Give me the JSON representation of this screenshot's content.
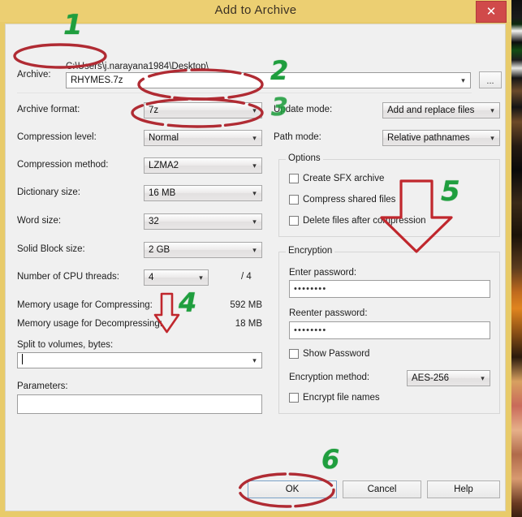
{
  "window": {
    "title": "Add to Archive",
    "close_label": "✕",
    "chrome_color": "#e8cb6a",
    "close_color": "#d04a4a"
  },
  "archive": {
    "label": "Archive:",
    "path": "C:\\Users\\j.narayana1984\\Desktop\\",
    "name": "RHYMES.7z",
    "browse_label": "..."
  },
  "left_fields": [
    {
      "label": "Archive format:",
      "value": "7z"
    },
    {
      "label": "Compression level:",
      "value": "Normal"
    },
    {
      "label": "Compression method:",
      "value": "LZMA2"
    },
    {
      "label": "Dictionary size:",
      "value": "16 MB"
    },
    {
      "label": "Word size:",
      "value": "32"
    },
    {
      "label": "Solid Block size:",
      "value": "2 GB"
    },
    {
      "label": "Number of CPU threads:",
      "value": "4",
      "suffix": "/ 4"
    }
  ],
  "memory": {
    "compress_label": "Memory usage for Compressing:",
    "compress_value": "592 MB",
    "decompress_label": "Memory usage for Decompressing:",
    "decompress_value": "18 MB"
  },
  "split": {
    "label": "Split to volumes, bytes:",
    "value": ""
  },
  "parameters": {
    "label": "Parameters:",
    "value": ""
  },
  "right_fields": [
    {
      "label": "Update mode:",
      "value": "Add and replace files"
    },
    {
      "label": "Path mode:",
      "value": "Relative pathnames"
    }
  ],
  "options": {
    "title": "Options",
    "items": [
      {
        "label": "Create SFX archive",
        "checked": false
      },
      {
        "label": "Compress shared files",
        "checked": false
      },
      {
        "label": "Delete files after compression",
        "checked": false
      }
    ]
  },
  "encryption": {
    "title": "Encryption",
    "enter_label": "Enter password:",
    "enter_value": "••••••••",
    "reenter_label": "Reenter password:",
    "reenter_value": "••••••••",
    "show_password_label": "Show Password",
    "show_password_checked": false,
    "method_label": "Encryption method:",
    "method_value": "AES-256",
    "encrypt_names_label": "Encrypt file names",
    "encrypt_names_checked": false
  },
  "buttons": {
    "ok": "OK",
    "cancel": "Cancel",
    "help": "Help"
  },
  "annotations": {
    "color_green": "#1f9e3e",
    "color_red": "#b02b33",
    "numbers": [
      "1",
      "2",
      "3",
      "4",
      "5",
      "6"
    ]
  }
}
